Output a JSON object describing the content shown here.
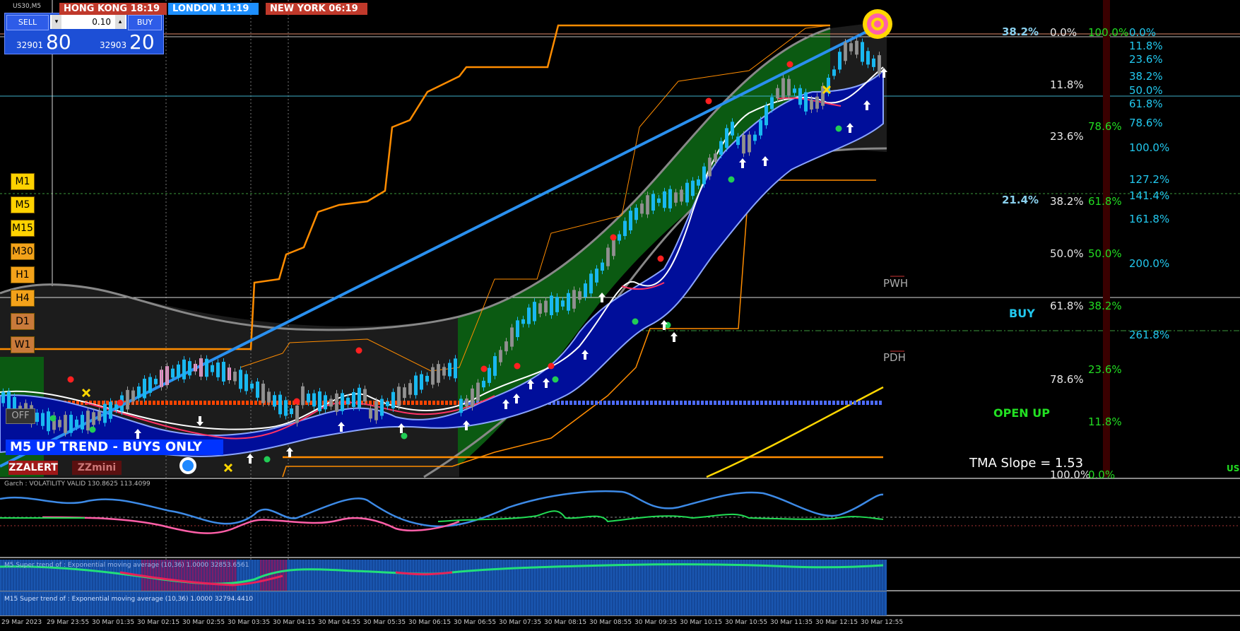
{
  "chart_title": "US30,M5",
  "trade_panel": {
    "sell_label": "SELL",
    "buy_label": "BUY",
    "lot_value": "0.10",
    "sell_price_prefix": "32901",
    "sell_price_big": "80",
    "buy_price_prefix": "32903",
    "buy_price_big": "20"
  },
  "sessions": [
    {
      "label": "HONG KONG  18:19",
      "color": "#c0392b"
    },
    {
      "label": "LONDON  11:19",
      "color": "#1e90ff"
    },
    {
      "label": "NEW YORK  06:19",
      "color": "#c0392b"
    }
  ],
  "timeframes": [
    {
      "label": "M1",
      "color": "#ffd200"
    },
    {
      "label": "M5",
      "color": "#ffd200"
    },
    {
      "label": "M15",
      "color": "#ffd200"
    },
    {
      "label": "M30",
      "color": "#f3a21a"
    },
    {
      "label": "H1",
      "color": "#f3a21a"
    },
    {
      "label": "H4",
      "color": "#f3a21a"
    },
    {
      "label": "D1",
      "color": "#c97a3a"
    },
    {
      "label": "W1",
      "color": "#c97a3a"
    }
  ],
  "off_label": "OFF",
  "trend_banner": "M5 UP TREND - BUYS ONLY",
  "zzalert_label": "ZZALERT",
  "zzmini_label": "ZZmini",
  "fib_left": [
    {
      "label": "38.2%"
    },
    {
      "label": "21.4%"
    }
  ],
  "fib_col_white": [
    {
      "label": "0.0%"
    },
    {
      "label": "11.8%"
    },
    {
      "label": "23.6%"
    },
    {
      "label": "38.2%"
    },
    {
      "label": "50.0%"
    },
    {
      "label": "61.8%"
    },
    {
      "label": "78.6%"
    },
    {
      "label": "100.0%"
    }
  ],
  "fib_col_green": [
    {
      "label": "100.0%"
    },
    {
      "label": "78.6%"
    },
    {
      "label": "61.8%"
    },
    {
      "label": "50.0%"
    },
    {
      "label": "38.2%"
    },
    {
      "label": "23.6%"
    },
    {
      "label": "11.8%"
    },
    {
      "label": "0.0%"
    }
  ],
  "fib_col_cyan": [
    {
      "label": "0.0%"
    },
    {
      "label": "11.8%"
    },
    {
      "label": "23.6%"
    },
    {
      "label": "38.2%"
    },
    {
      "label": "50.0%"
    },
    {
      "label": "61.8%"
    },
    {
      "label": "78.6%"
    },
    {
      "label": "100.0%"
    },
    {
      "label": "127.2%"
    },
    {
      "label": "141.4%"
    },
    {
      "label": "161.8%"
    },
    {
      "label": "200.0%"
    },
    {
      "label": "261.8%"
    }
  ],
  "pwh_label": "PWH",
  "pdh_label": "PDH",
  "buy_signal": "BUY",
  "open_up": "OPEN UP",
  "tma_slope": "TMA Slope = 1.53",
  "right_edge_label": "US",
  "garch_label": "Garch : VOLATILITY VALID 130.8625 113.4099",
  "st_m5_label": "M5  Super trend of : Exponential moving average (10,36) 1.0000 32853.6561",
  "st_m15_label": "M15  Super trend of : Exponential moving average (10,36) 1.0000 32794.4410",
  "x_axis": [
    "29 Mar 2023",
    "29 Mar 23:55",
    "30 Mar 01:35",
    "30 Mar 02:15",
    "30 Mar 02:55",
    "30 Mar 03:35",
    "30 Mar 04:15",
    "30 Mar 04:55",
    "30 Mar 05:35",
    "30 Mar 06:15",
    "30 Mar 06:55",
    "30 Mar 07:35",
    "30 Mar 08:15",
    "30 Mar 08:55",
    "30 Mar 09:35",
    "30 Mar 10:15",
    "30 Mar 10:55",
    "30 Mar 11:35",
    "30 Mar 12:15",
    "30 Mar 12:55"
  ],
  "colors": {
    "bull_candle": "#19b8f0",
    "bear_candle": "#8a8a8a",
    "tma_band": "#000e9a",
    "channel_up": "#0b5a12",
    "trendline": "#2a90ef",
    "orange_line": "#ff8c00",
    "yellow_line": "#ffd700"
  }
}
